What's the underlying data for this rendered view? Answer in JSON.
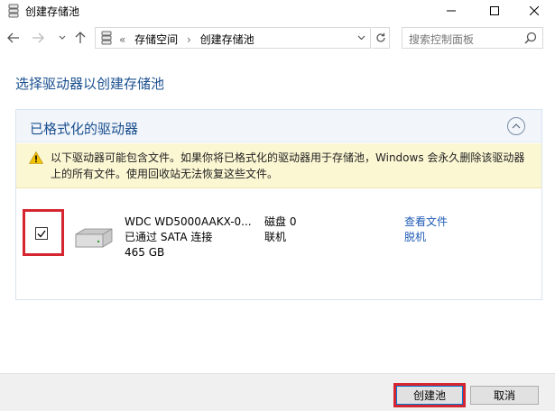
{
  "window": {
    "title": "创建存储池"
  },
  "address": {
    "overflow_glyph": "«",
    "crumbs": [
      "存储空间",
      "创建存储池"
    ],
    "separator": "›"
  },
  "search": {
    "placeholder": "搜索控制面板"
  },
  "main": {
    "heading": "选择驱动器以创建存储池",
    "panel_title": "已格式化的驱动器",
    "warning": "以下驱动器可能包含文件。如果你将已格式化的驱动器用于存储池，Windows 会永久删除该驱动器上的所有文件。使用回收站无法恢复这些文件。",
    "drive": {
      "checked": true,
      "name": "WDC WD5000AAKX-0...",
      "connection": "已通过 SATA 连接",
      "size": "465 GB",
      "disk": "磁盘 0",
      "status": "联机",
      "link_view": "查看文件",
      "link_offline": "脱机"
    }
  },
  "footer": {
    "create_label": "创建池",
    "cancel_label": "取消"
  },
  "colors": {
    "heading": "#1a4f8f",
    "link": "#1f5bb5",
    "highlight": "#d52630",
    "warning_bg": "#fcf7d3"
  },
  "icons": [
    "storage-spaces-icon",
    "minimize-icon",
    "maximize-icon",
    "close-icon",
    "back-arrow-icon",
    "forward-arrow-icon",
    "recent-dropdown-icon",
    "up-arrow-icon",
    "refresh-icon",
    "search-icon",
    "collapse-chevron-icon",
    "warning-icon",
    "hard-drive-icon",
    "checkmark-icon"
  ]
}
